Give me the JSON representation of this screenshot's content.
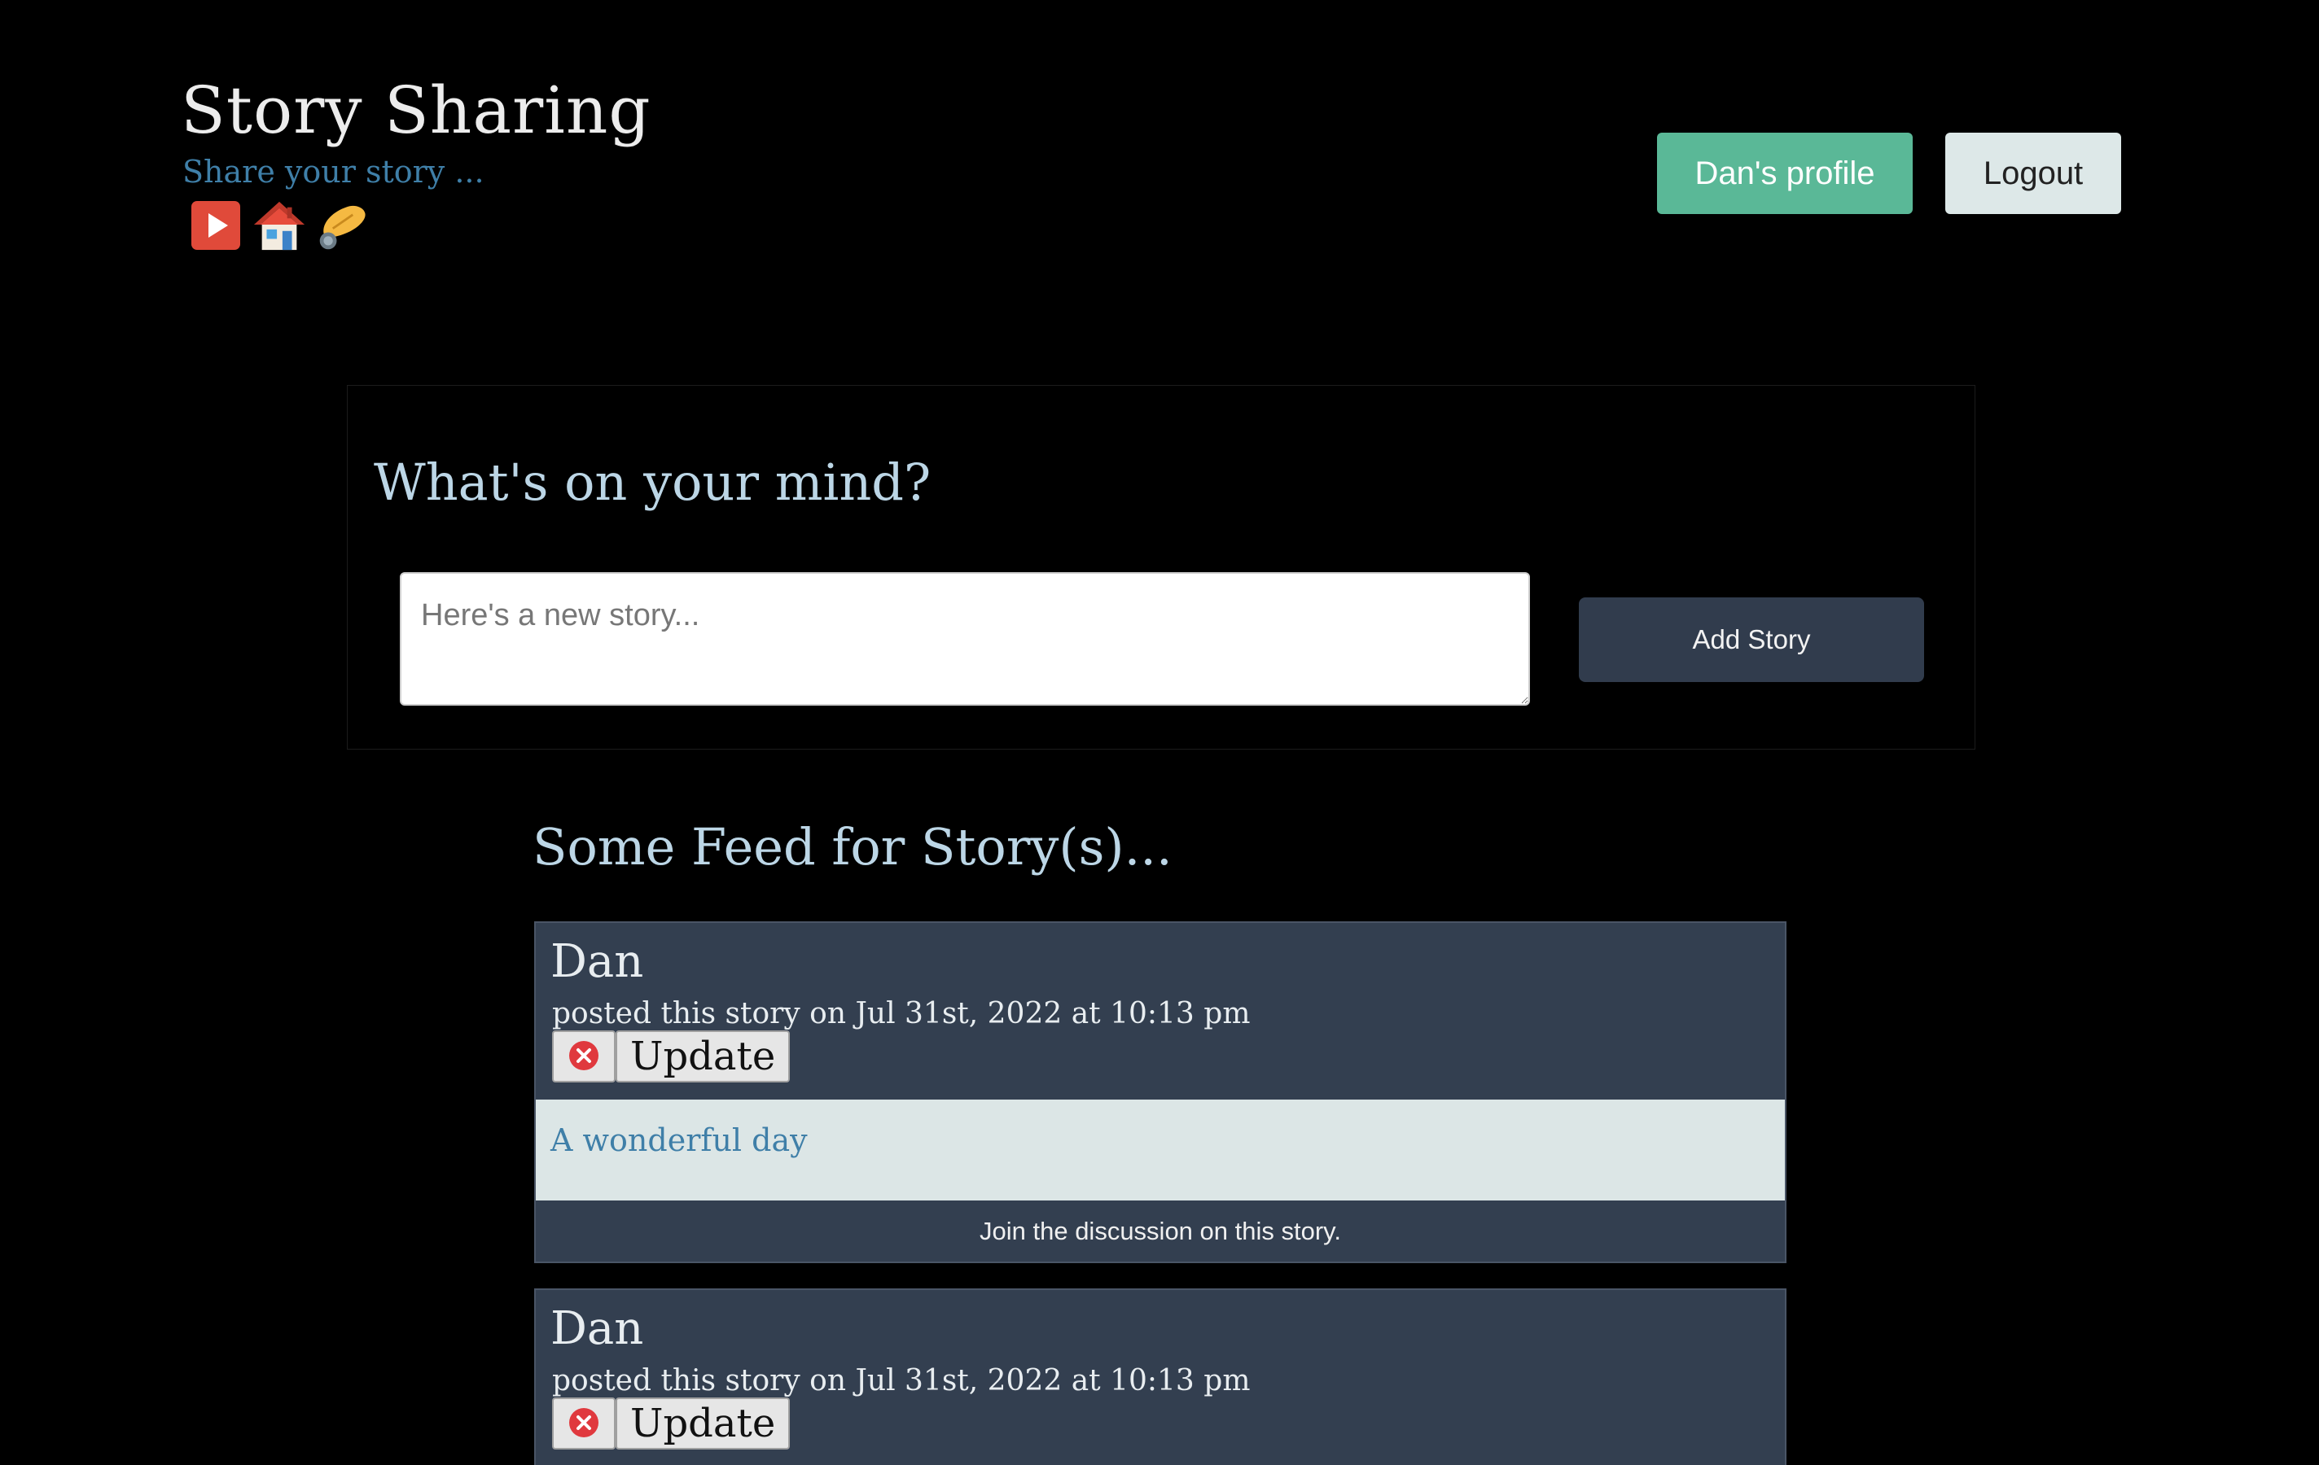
{
  "header": {
    "title": "Story Sharing",
    "subtitle": "Share your story ...",
    "icons": [
      "youtube-icon",
      "house-icon",
      "hand-icon"
    ],
    "profile_label": "Dan's profile",
    "logout_label": "Logout"
  },
  "composer": {
    "heading": "What's on your mind?",
    "placeholder": "Here's a new story...",
    "add_label": "Add Story"
  },
  "feed": {
    "heading": "Some Feed for Story(s)...",
    "stories": [
      {
        "author": "Dan",
        "meta": "posted this story on Jul 31st, 2022 at 10:13 pm",
        "update_label": "Update",
        "content": "A wonderful day",
        "footer": "Join the discussion on this story."
      },
      {
        "author": "Dan",
        "meta": "posted this story on Jul 31st, 2022 at 10:13 pm",
        "update_label": "Update"
      }
    ]
  },
  "colors": {
    "background": "#000000",
    "accent_green": "#5ab897",
    "card_bg": "#333f50",
    "heading_blue": "#bcd6e6",
    "link_blue": "#3f7fa8"
  }
}
